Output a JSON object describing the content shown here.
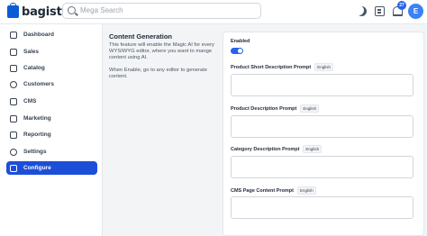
{
  "header": {
    "logo_text": "bagisto",
    "search_placeholder": "Mega Search",
    "notification_count": "27",
    "avatar_initial": "E"
  },
  "sidebar": {
    "items": [
      {
        "label": "Dashboard",
        "icon": "dashboard-icon"
      },
      {
        "label": "Sales",
        "icon": "sales-icon"
      },
      {
        "label": "Catalog",
        "icon": "catalog-icon"
      },
      {
        "label": "Customers",
        "icon": "customers-icon"
      },
      {
        "label": "CMS",
        "icon": "cms-icon"
      },
      {
        "label": "Marketing",
        "icon": "marketing-icon"
      },
      {
        "label": "Reporting",
        "icon": "reporting-icon"
      },
      {
        "label": "Settings",
        "icon": "settings-icon"
      },
      {
        "label": "Configure",
        "icon": "configure-icon",
        "active": true
      }
    ]
  },
  "section": {
    "title": "Content Generation",
    "description": "This feature will enable the Magic AI for every WYSIWYG editor, where you want to mange content using AI.",
    "description2": "When Enable, go to any editor to generate content."
  },
  "form": {
    "enabled_label": "Enabled",
    "enabled_value": true,
    "fields": [
      {
        "label": "Product Short Description Prompt",
        "locale": "English",
        "value": ""
      },
      {
        "label": "Product Description Prompt",
        "locale": "English",
        "value": ""
      },
      {
        "label": "Category Description Prompt",
        "locale": "English",
        "value": ""
      },
      {
        "label": "CMS Page Content Prompt",
        "locale": "English",
        "value": ""
      }
    ]
  },
  "colors": {
    "accent": "#1d4ed8",
    "toggle_on": "#2563eb"
  }
}
